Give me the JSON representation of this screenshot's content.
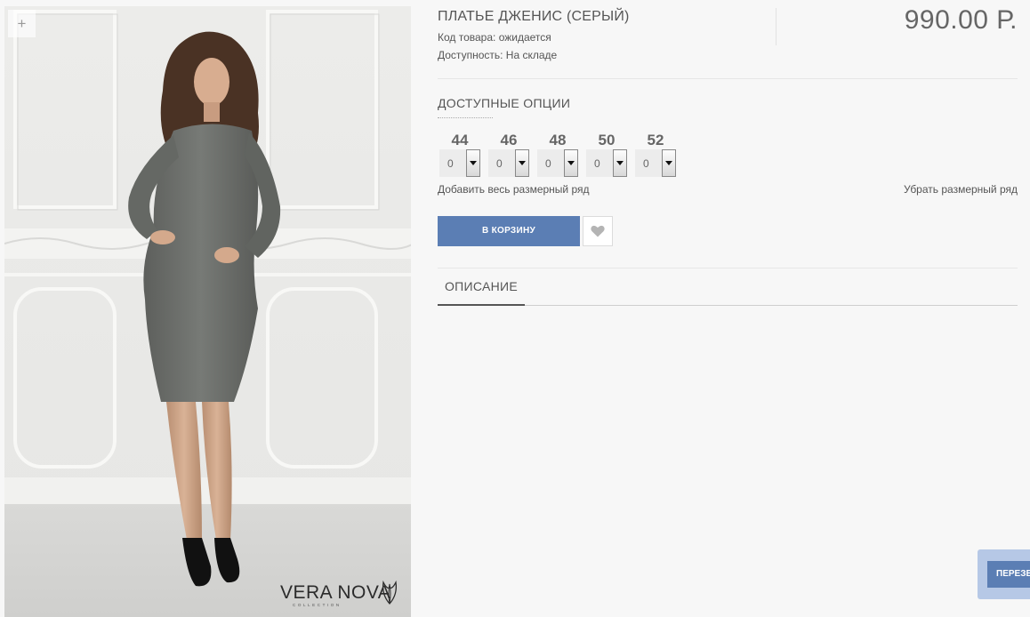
{
  "product": {
    "title": "ПЛАТЬЕ ДЖЕНИС (СЕРЫЙ)",
    "code": "Код товара: ожидается",
    "availability": "Доступность: На складе",
    "price": "990.00 Р."
  },
  "gallery": {
    "zoom_icon": "plus-icon",
    "zoom_label": "+",
    "brand_name": "VERA NOVA",
    "brand_sub": "COLLECTION"
  },
  "options": {
    "heading": "ДОСТУПНЫЕ ОПЦИИ",
    "sizes": [
      {
        "label": "44",
        "value": "0"
      },
      {
        "label": "46",
        "value": "0"
      },
      {
        "label": "48",
        "value": "0"
      },
      {
        "label": "50",
        "value": "0"
      },
      {
        "label": "52",
        "value": "0"
      }
    ],
    "add_all": "Добавить весь размерный ряд",
    "remove_all": "Убрать размерный ряд"
  },
  "actions": {
    "cart_label": "В КОРЗИНУ",
    "wishlist_icon": "heart-icon"
  },
  "tabs": [
    {
      "label": "ОПИСАНИЕ",
      "active": true
    }
  ],
  "callback": {
    "label": "ПЕРЕЗВ"
  },
  "colors": {
    "accent": "#5b7eb4",
    "background": "#f7f7f7",
    "callback_halo": "#b6c8e6"
  }
}
